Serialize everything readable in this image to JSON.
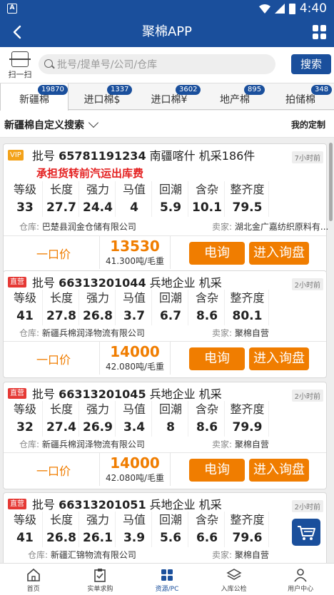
{
  "statusbar": {
    "app_indicator": "A",
    "time": "4:40"
  },
  "titlebar": {
    "title": "聚棉APP"
  },
  "search": {
    "scan_label": "扫一扫",
    "placeholder": "批号/提单号/公司/仓库",
    "button": "搜索"
  },
  "tabs": [
    {
      "label": "新疆棉",
      "badge": "19870"
    },
    {
      "label": "进口棉$",
      "badge": "1337"
    },
    {
      "label": "进口棉¥",
      "badge": "3602"
    },
    {
      "label": "地产棉",
      "badge": "895"
    },
    {
      "label": "拍储棉",
      "badge": "348"
    }
  ],
  "filter": {
    "label": "新疆棉自定义搜索",
    "my_custom": "我的定制"
  },
  "param_labels": [
    "等级",
    "长度",
    "强力",
    "马值",
    "回潮",
    "含杂",
    "整齐度"
  ],
  "common": {
    "batch_prefix": "批号",
    "warehouse_prefix": "仓库:",
    "seller_prefix": "卖家:",
    "price_label": "一口价",
    "call_btn": "电询",
    "inquiry_btn": "进入询盘"
  },
  "cards": [
    {
      "tag": "VIP",
      "batch": "65781191234",
      "desc": "南疆喀什 机采186件",
      "time": "7小时前",
      "notice": "承担货转前汽运出库费",
      "values": [
        "33",
        "27.7",
        "24.4",
        "4",
        "5.9",
        "10.1",
        "79.5"
      ],
      "warehouse": "巴楚县润金仓储有限公司",
      "seller": "湖北金广嘉纺织原料有...",
      "price": "13530",
      "per": "41.300吨/毛重"
    },
    {
      "tag": "直营",
      "batch": "66313201044",
      "desc": "兵地企业 机采",
      "time": "2小时前",
      "values": [
        "41",
        "27.8",
        "26.8",
        "3.7",
        "6.7",
        "8.6",
        "80.1"
      ],
      "warehouse": "新疆兵棉润泽物流有限公司",
      "seller": "聚棉自营",
      "price": "14000",
      "per": "42.080吨/毛重"
    },
    {
      "tag": "直营",
      "batch": "66313201045",
      "desc": "兵地企业 机采",
      "time": "2小时前",
      "values": [
        "32",
        "27.4",
        "26.9",
        "3.4",
        "8",
        "8.6",
        "79.9"
      ],
      "warehouse": "新疆兵棉润泽物流有限公司",
      "seller": "聚棉自营",
      "price": "14000",
      "per": "42.080吨/毛重"
    },
    {
      "tag": "直营",
      "batch": "66313201051",
      "desc": "兵地企业 机采",
      "time": "2小时前",
      "values": [
        "41",
        "26.8",
        "26.1",
        "3.9",
        "5.6",
        "6.6",
        "79.6"
      ],
      "warehouse": "新疆汇锦物流有限公司",
      "seller": "聚棉自营"
    }
  ],
  "bottomnav": [
    {
      "label": "首页",
      "icon": "home-icon"
    },
    {
      "label": "实单求购",
      "icon": "clipboard-icon"
    },
    {
      "label": "资源/PC",
      "icon": "grid-icon"
    },
    {
      "label": "入库公检",
      "icon": "layers-icon"
    },
    {
      "label": "用户中心",
      "icon": "user-icon"
    }
  ],
  "colors": {
    "brand": "#1a4f9c",
    "accent": "#f07d00",
    "alert": "#e41e1e"
  }
}
